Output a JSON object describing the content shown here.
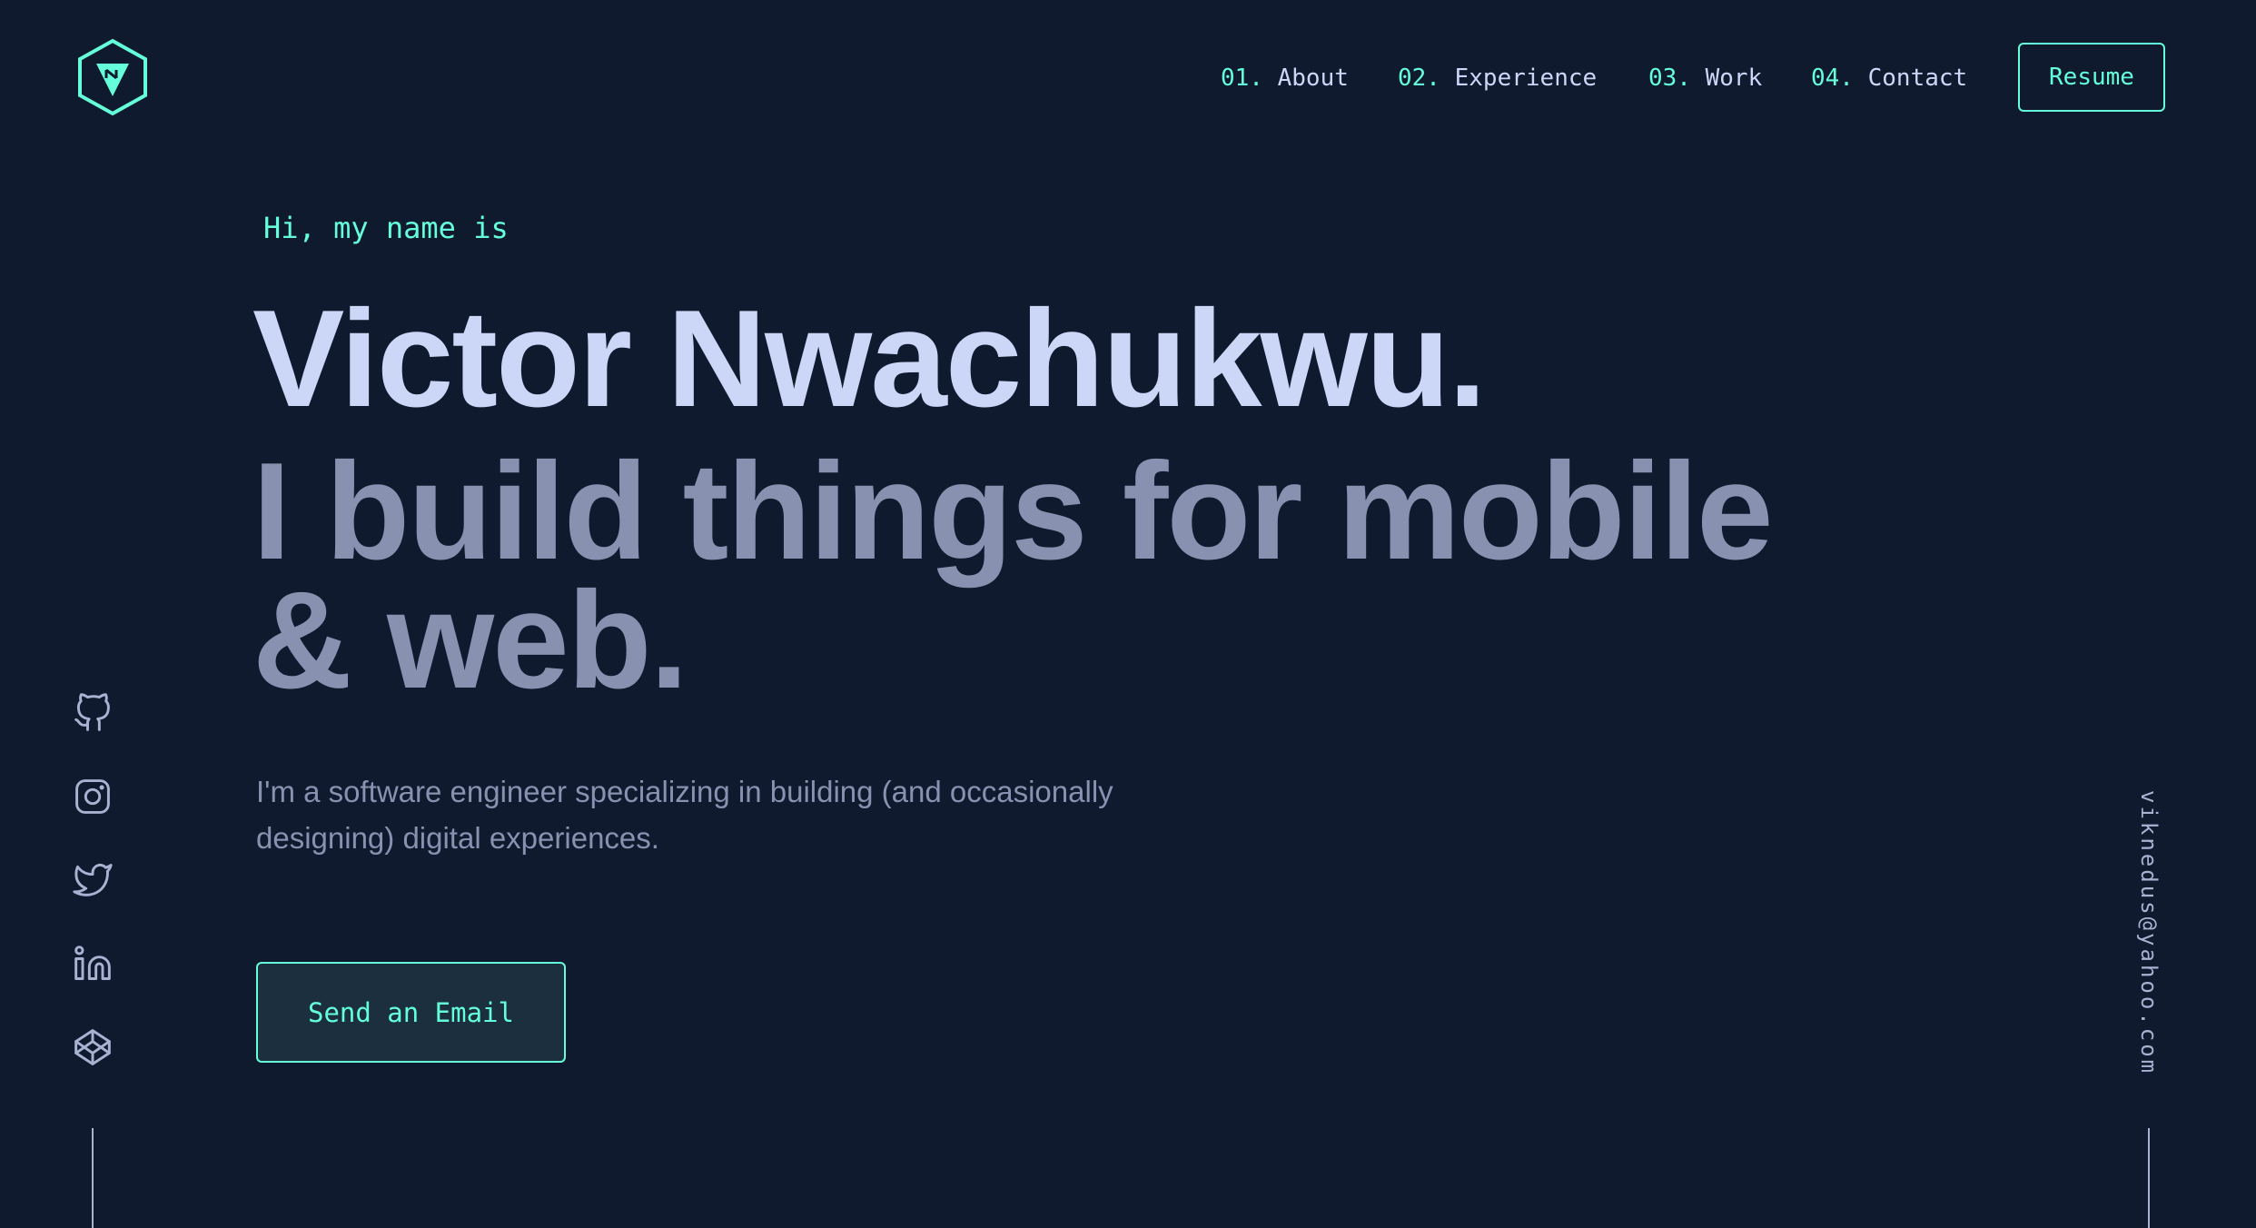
{
  "brand": {
    "logo_icon": "hexagon-vn-logo-icon",
    "accent_color": "#64ffda",
    "background_color": "#0f1a2e"
  },
  "nav": {
    "items": [
      {
        "num": "01.",
        "label": "About"
      },
      {
        "num": "02.",
        "label": "Experience"
      },
      {
        "num": "03.",
        "label": "Work"
      },
      {
        "num": "04.",
        "label": "Contact"
      }
    ],
    "resume_label": "Resume"
  },
  "hero": {
    "intro": "Hi, my name is",
    "name": "Victor Nwachukwu.",
    "tagline": "I build things for mobile & web.",
    "description": "I'm a software engineer specializing in building (and occasionally designing) digital experiences.",
    "cta_label": "Send an Email"
  },
  "social": {
    "icons": [
      "github-icon",
      "instagram-icon",
      "twitter-icon",
      "linkedin-icon",
      "codepen-icon"
    ]
  },
  "side_email": "viknedus@yahoo.com"
}
